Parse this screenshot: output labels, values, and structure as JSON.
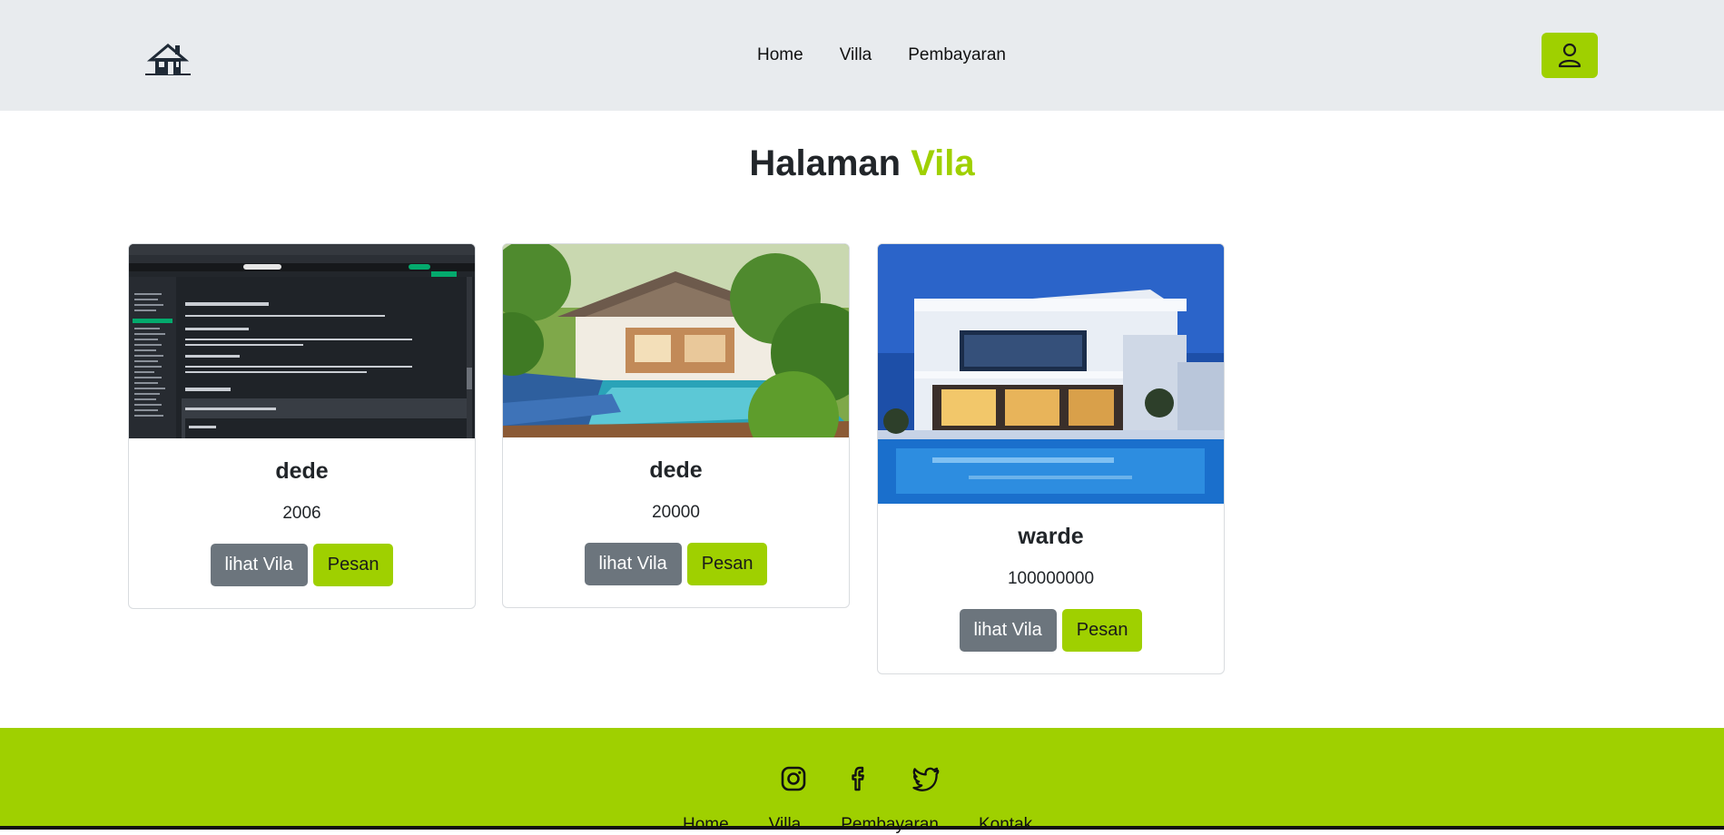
{
  "nav": {
    "links": [
      "Home",
      "Villa",
      "Pembayaran"
    ],
    "user_icon": "user-icon",
    "logo_icon": "house-logo-icon"
  },
  "title": {
    "main": "Halaman",
    "accent": "Vila"
  },
  "colors": {
    "accent": "#9fd000",
    "secondary_button": "#6c757d",
    "header_bg": "#e8ebee"
  },
  "villas": [
    {
      "name": "dede",
      "price": "2006",
      "view_label": "lihat Vila",
      "book_label": "Pesan",
      "image": "html-tutorial-screenshot"
    },
    {
      "name": "dede",
      "price": "20000",
      "view_label": "lihat Vila",
      "book_label": "Pesan",
      "image": "tropical-villa-pool-photo"
    },
    {
      "name": "warde",
      "price": "100000000",
      "view_label": "lihat Vila",
      "book_label": "Pesan",
      "image": "modern-villa-night-photo"
    }
  ],
  "footer": {
    "socials": [
      "instagram-icon",
      "facebook-icon",
      "twitter-icon"
    ],
    "links": [
      "Home",
      "Villa",
      "Pembayaran",
      "Kontak"
    ]
  }
}
